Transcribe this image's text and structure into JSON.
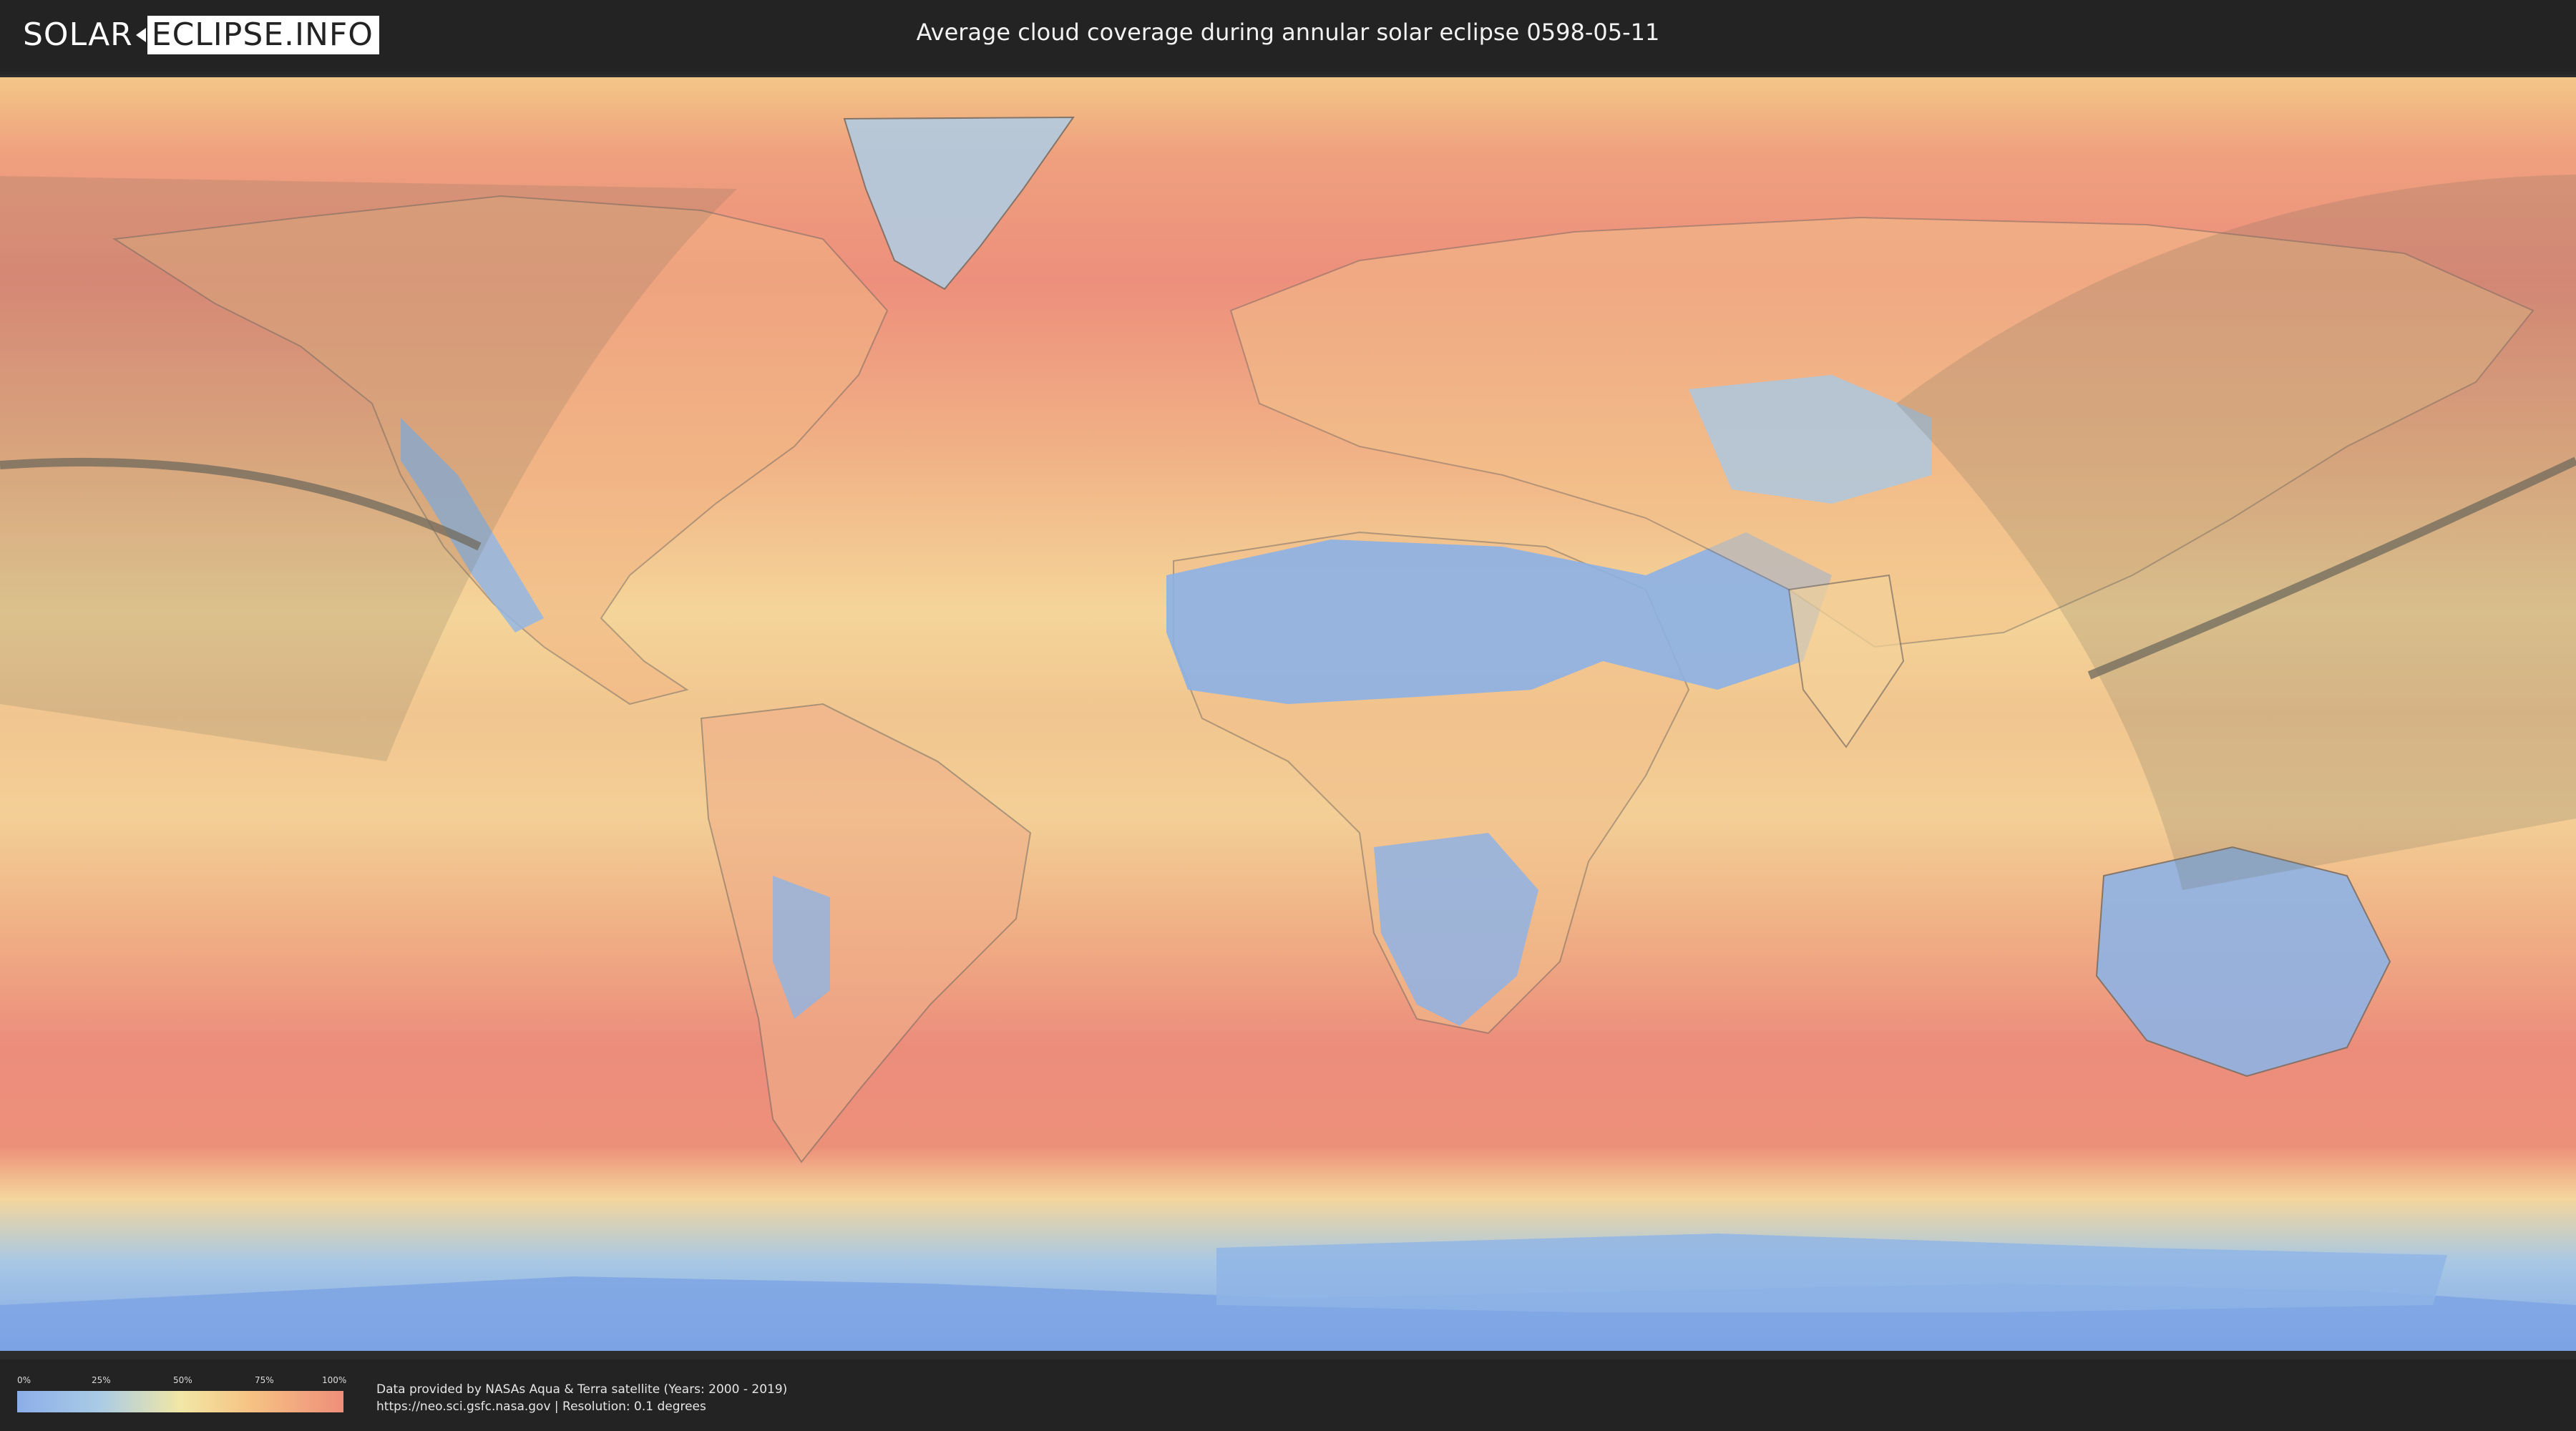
{
  "header": {
    "logo_left": "SOLAR",
    "logo_right": "ECLIPSE.INFO",
    "title": "Average cloud coverage during annular solar eclipse 0598-05-11"
  },
  "map": {
    "icon": "world-map-icon",
    "colors": {
      "ocean_high_cloud": "#ef8f78",
      "mid_cloud": "#f4d99a",
      "low_cloud": "#8db3e6",
      "eclipse_shadow": "#6b6b5a"
    }
  },
  "legend": {
    "ticks": [
      "0%",
      "25%",
      "50%",
      "75%",
      "100%"
    ],
    "colors": [
      "#8caee8",
      "#a9cbe6",
      "#f1e7a6",
      "#f6c585",
      "#ef8e79"
    ]
  },
  "credits": {
    "line1": "Data provided by NASAs Aqua & Terra satellite (Years: 2000 - 2019)",
    "line2": "https://neo.sci.gsfc.nasa.gov | Resolution: 0.1 degrees"
  }
}
